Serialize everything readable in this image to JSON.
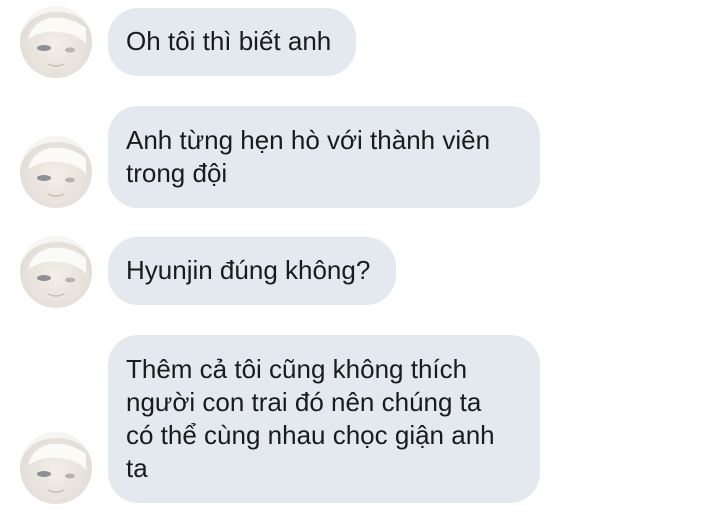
{
  "messages": [
    {
      "text": "Oh tôi thì biết anh"
    },
    {
      "text": "Anh từng hẹn hò với thành viên\ntrong đội"
    },
    {
      "text": "Hyunjin đúng không?"
    },
    {
      "text": "Thêm cả tôi cũng không thích\nngười con trai đó nên chúng ta\ncó thể cùng nhau chọc giận anh\nta"
    }
  ],
  "colors": {
    "bubble": "#e3e9ef",
    "text": "#1b1b1b",
    "background": "#ffffff"
  },
  "avatar_icon": "avatar-icon"
}
